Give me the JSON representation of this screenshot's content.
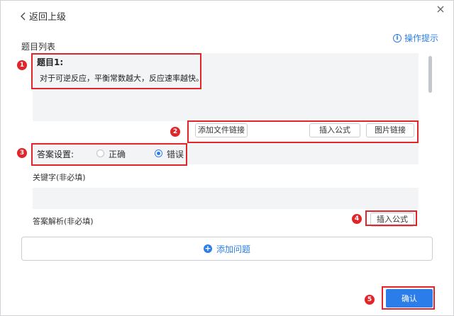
{
  "header": {
    "back_label": "返回上级",
    "tips_label": "操作提示",
    "tips_icon_glyph": "i"
  },
  "question_list": {
    "label": "题目列表",
    "title": "题目1:",
    "text": "对于可逆反应，平衡常数越大，反应速率越快。"
  },
  "toolbar": {
    "add_file_link": "添加文件链接",
    "insert_formula": "插入公式",
    "image_link": "图片链接"
  },
  "answer": {
    "label": "答案设置:",
    "options": [
      "正确",
      "错误"
    ],
    "selected": "错误"
  },
  "keywords": {
    "label": "关键字(非必填)"
  },
  "explanation": {
    "label": "答案解析(非必填)",
    "insert_formula": "插入公式"
  },
  "add_question": {
    "label": "添加问题",
    "icon_glyph": "+"
  },
  "confirm_label": "确认",
  "annotations": [
    "1",
    "2",
    "3",
    "4",
    "5"
  ],
  "colors": {
    "accent": "#2b7de9",
    "highlight": "#e0262b",
    "panel": "#f3f4f6"
  }
}
